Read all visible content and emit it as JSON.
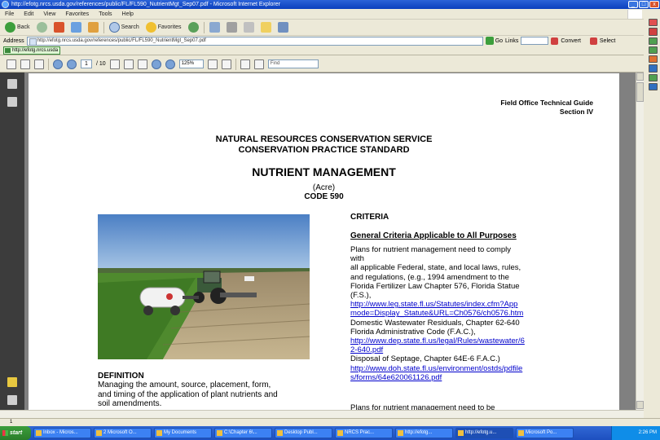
{
  "window": {
    "title": "http://efotg.nrcs.usda.gov/references/public/FL/FL590_NutrientMgt_Sep07.pdf - Microsoft Internet Explorer",
    "controls": [
      "_",
      "□",
      "x"
    ]
  },
  "menu": [
    "File",
    "Edit",
    "View",
    "Favorites",
    "Tools",
    "Help"
  ],
  "toolbar": {
    "back_label": "Back",
    "search_label": "Search",
    "favorites_label": "Favorites"
  },
  "address": {
    "label": "Address",
    "url": "http://efotg.nrcs.usda.gov/references/public/FL/FL590_NutrientMgt_Sep07.pdf",
    "go_label": "Go",
    "links_label": "Links",
    "convert_label": "Convert",
    "select_label": "Select"
  },
  "links_tab": "http://efotg.nrcs.usda",
  "pdf_toolbar": {
    "current_page": "1",
    "page_total": "/ 10",
    "zoom": "125%",
    "find_placeholder": "Find"
  },
  "document": {
    "header_line1": "Field Office Technical Guide",
    "header_line2": "Section IV",
    "agency": "NATURAL RESOURCES CONSERVATION SERVICE",
    "standard": "CONSERVATION PRACTICE STANDARD",
    "title": "NUTRIENT MANAGEMENT",
    "unit": "(Acre)",
    "code": "CODE 590",
    "criteria_heading": "CRITERIA",
    "general_heading": "General Criteria Applicable to All Purposes",
    "right_lines": [
      {
        "text": "Plans for nutrient management need to comply",
        "link": false
      },
      {
        "text": "        with",
        "link": false
      },
      {
        "text": "all applicable Federal, state, and local laws, rules,",
        "link": false
      },
      {
        "text": "and regulations, (e.g., 1994 amendment to the",
        "link": false
      },
      {
        "text": "Florida Fertilizer Law Chapter 576, Florida Statue",
        "link": false
      },
      {
        "text": "(F.S.),",
        "link": false
      },
      {
        "text": "http://www.leg.state.fl.us/Statutes/index.cfm?App",
        "link": true
      },
      {
        "text": "mode=Display_Statute&URL=Ch0576/ch0576.htm",
        "link": true
      },
      {
        "text": "Domestic Wastewater Residuals, Chapter 62-640",
        "link": false
      },
      {
        "text": "Florida Administrative Code (F.A.C.),",
        "link": false
      },
      {
        "text": "http://www.dep.state.fl.us/legal/Rules/wastewater/6",
        "link": true
      },
      {
        "text": "2-640.pdf",
        "link": true
      },
      {
        "text": "Disposal of Septage, Chapter 64E-6 F.A.C.)",
        "link": false
      },
      {
        "text": "http://www.doh.state.fl.us/environment/ostds/pdfile",
        "link": true
      },
      {
        "text": "s/forms/64e620061126.pdf",
        "link": true
      }
    ],
    "right_bottom": "Plans for nutrient management need to be",
    "definition_heading": "DEFINITION",
    "definition_lines": [
      "Managing the amount, source, placement, form,",
      "and timing of the application of plant nutrients and",
      "soil amendments."
    ]
  },
  "status": {
    "text": "1"
  },
  "taskbar": {
    "start_label": "start",
    "items": [
      "Inbox - Micros...",
      "2 Microsoft O...",
      "My Documents",
      "C:\\Chapter 6\\...",
      "Desktop Publ...",
      "NRCS Prac...",
      "http://efotg...",
      "http://efotg.u...",
      "Microsoft Po..."
    ],
    "active_index": 7,
    "clock": "2:26 PM"
  },
  "colors": {
    "title_blue": "#0a3fbd",
    "link_blue": "#0000cc",
    "nav_dark": "#3c3c3c",
    "taskbar_blue": "#1d4fbf",
    "start_green": "#3c9e3c"
  }
}
